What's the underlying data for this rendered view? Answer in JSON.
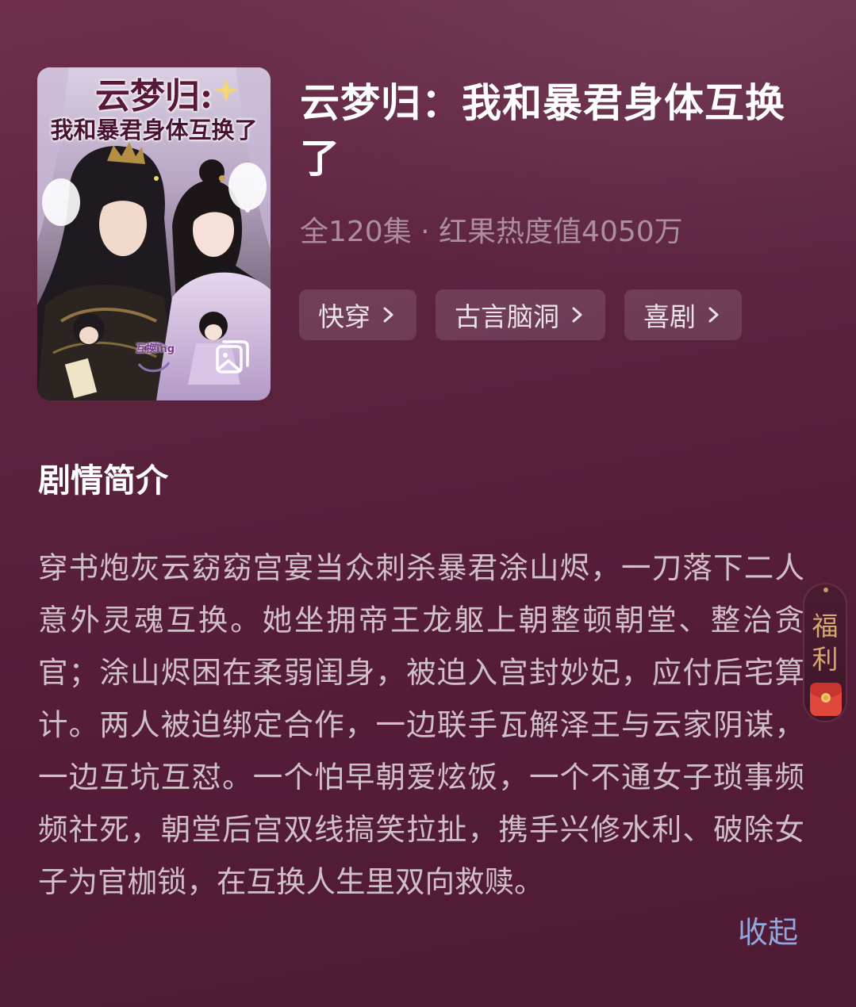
{
  "drama": {
    "title": "云梦归：我和暴君身体互换了",
    "meta": "全120集 · 红果热度值4050万",
    "tags": [
      {
        "label": "快穿"
      },
      {
        "label": "古言脑洞"
      },
      {
        "label": "喜剧"
      }
    ]
  },
  "cover": {
    "title_line1": "云梦归:",
    "title_line2": "我和暴君身体互换了",
    "swap_badge": "互换ing"
  },
  "synopsis": {
    "heading": "剧情简介",
    "text": "穿书炮灰云窈窈宫宴当众刺杀暴君涂山烬，一刀落下二人意外灵魂互换。她坐拥帝王龙躯上朝整顿朝堂、整治贪官；涂山烬困在柔弱闺身，被迫入宫封妙妃，应付后宅算计。两人被迫绑定合作，一边联手瓦解泽王与云家阴谋，一边互坑互怼。一个怕早朝爱炫饭，一个不通女子琐事频频社死，朝堂后宫双线搞笑拉扯，携手兴修水利、破除女子为官枷锁，在互换人生里双向救赎。",
    "collapse_label": "收起"
  },
  "welfare": {
    "label": "福利"
  },
  "icons": {
    "gallery": "gallery-icon",
    "chevron": "chevron-right-icon",
    "red_packet": "red-packet-icon"
  },
  "colors": {
    "background": "#5d2440",
    "link": "#8fa8dd",
    "welfare_gold": "#d6a86e"
  }
}
